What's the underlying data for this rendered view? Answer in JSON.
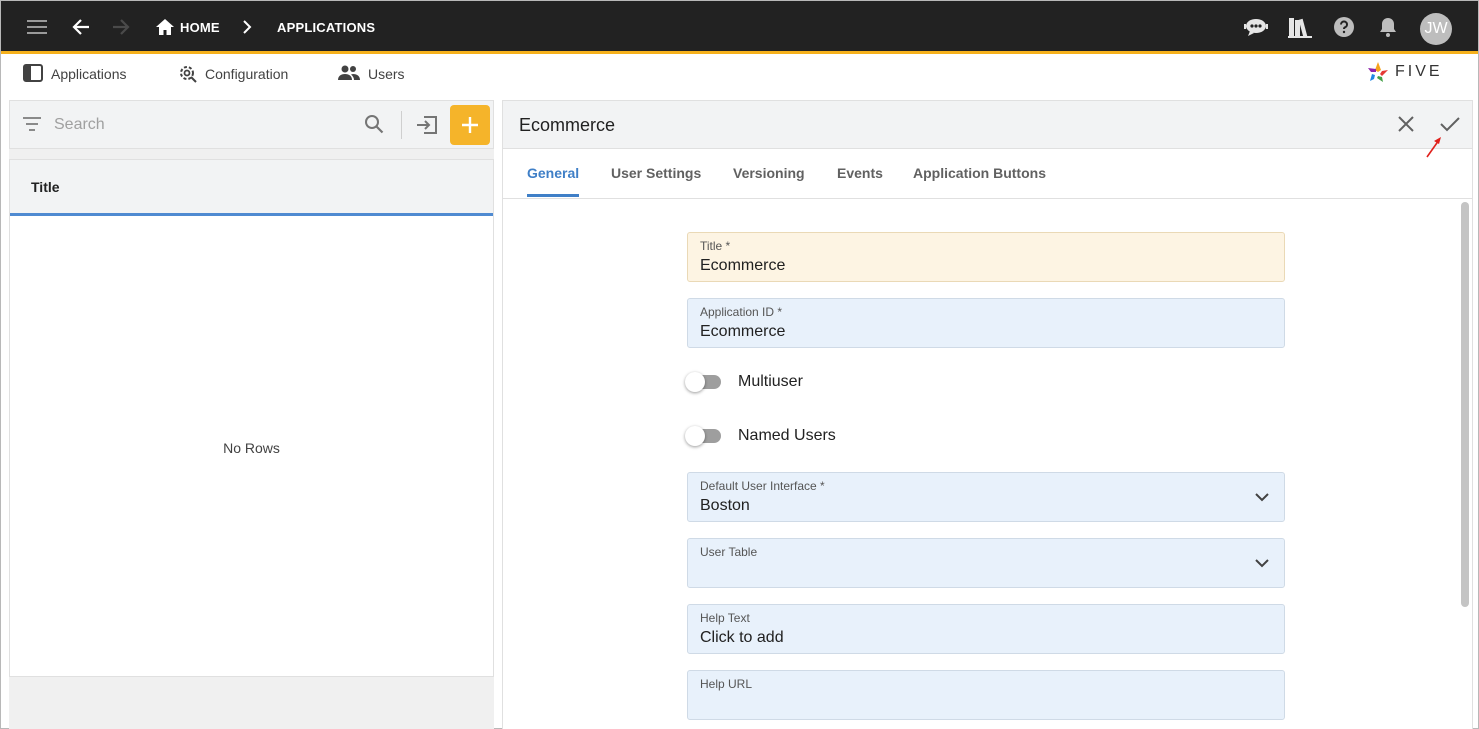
{
  "topbar": {
    "breadcrumb_home": "HOME",
    "breadcrumb_current": "APPLICATIONS",
    "avatar_initials": "JW",
    "icons": [
      "menu-icon",
      "back-arrow-icon",
      "forward-arrow-icon",
      "home-icon",
      "chevron-right-icon",
      "chat-bot-icon",
      "library-icon",
      "help-icon",
      "bell-icon"
    ]
  },
  "subnav": {
    "items": [
      {
        "label": "Applications",
        "icon": "applications-icon"
      },
      {
        "label": "Configuration",
        "icon": "gear-icon"
      },
      {
        "label": "Users",
        "icon": "users-icon"
      }
    ],
    "logo_text": "FIVE"
  },
  "left_panel": {
    "search_placeholder": "Search",
    "column_header": "Title",
    "empty_text": "No Rows"
  },
  "record": {
    "title": "Ecommerce",
    "tabs": [
      "General",
      "User Settings",
      "Versioning",
      "Events",
      "Application Buttons"
    ],
    "active_tab": "General",
    "fields": {
      "title": {
        "label": "Title *",
        "value": "Ecommerce"
      },
      "app_id": {
        "label": "Application ID *",
        "value": "Ecommerce"
      },
      "multiuser": {
        "label": "Multiuser",
        "checked": false
      },
      "named_users": {
        "label": "Named Users",
        "checked": false
      },
      "default_ui": {
        "label": "Default User Interface *",
        "value": "Boston"
      },
      "user_table": {
        "label": "User Table",
        "value": ""
      },
      "help_text": {
        "label": "Help Text",
        "value": "Click to add"
      },
      "help_url": {
        "label": "Help URL",
        "value": ""
      }
    }
  },
  "colors": {
    "topbar_bg": "#222222",
    "accent_yellow": "#f6b11c",
    "tab_active": "#3f7fc7",
    "field_bg": "#e8f1fb",
    "required_field_bg": "#fdf4e3"
  }
}
